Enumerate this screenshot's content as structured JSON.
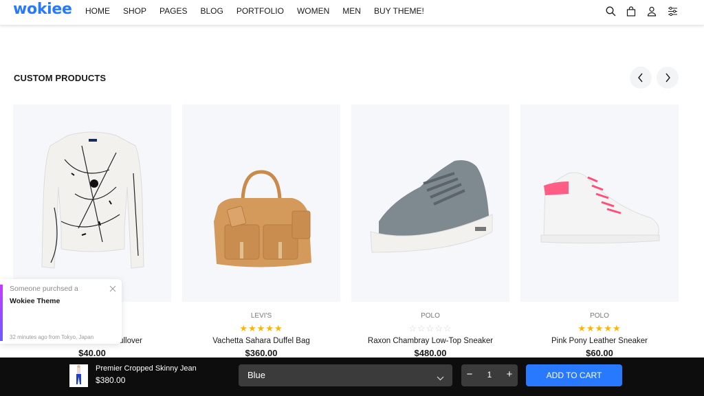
{
  "header": {
    "logo": "wokiee",
    "nav": [
      "HOME",
      "SHOP",
      "PAGES",
      "BLOG",
      "PORTFOLIO",
      "WOMEN",
      "MEN",
      "BUY THEME!"
    ],
    "icons": [
      "search-icon",
      "shopping-bag-icon",
      "user-icon",
      "settings-sliders-icon"
    ]
  },
  "section": {
    "title": "CUSTOM PRODUCTS",
    "prev_icon": "chevron-left-icon",
    "next_icon": "chevron-right-icon"
  },
  "products": [
    {
      "brand": "",
      "rating": null,
      "name": "ullover",
      "price": "$40.00"
    },
    {
      "brand": "LEVI'S",
      "rating": 5,
      "name": "Vachetta Sahara Duffel Bag",
      "price": "$360.00"
    },
    {
      "brand": "POLO",
      "rating": 0,
      "name": "Raxon Chambray Low-Top Sneaker",
      "price": "$480.00"
    },
    {
      "brand": "POLO",
      "rating": 5,
      "name": "Pink Pony Leather Sneaker",
      "price": "$60.00"
    }
  ],
  "popup": {
    "line1": "Someone purchsed a",
    "line2": "Wokiee Theme",
    "line3": "32 minutes ago from Tokyo, Japan"
  },
  "sticky_bar": {
    "product_name": "Premier Cropped Skinny Jean",
    "product_price": "$380.00",
    "color_select": "Blue",
    "quantity": "1",
    "add_to_cart": "ADD TO CART"
  },
  "colors": {
    "brand_blue": "#2879fe",
    "star": "#ffb400",
    "sticky_bg": "#0d0d0d"
  }
}
